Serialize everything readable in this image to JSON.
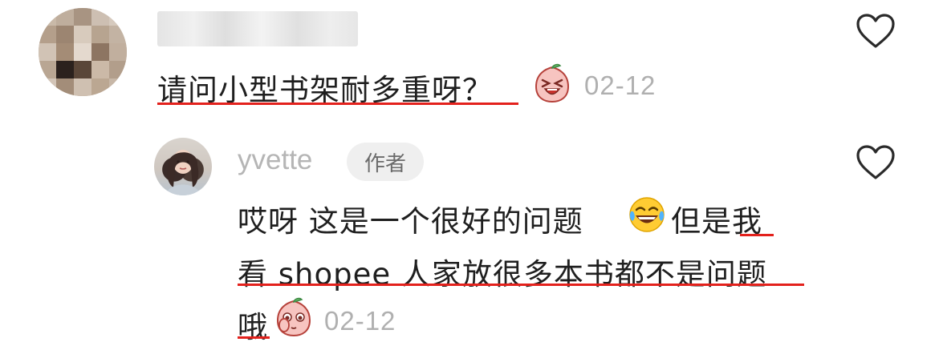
{
  "comment": {
    "text": "请问小型书架耐多重呀？",
    "date": "02-12",
    "sticker": "laughing-peach-sticker",
    "like_icon": "heart-outline-icon"
  },
  "reply": {
    "username": "yvette",
    "author_badge": "作者",
    "line1_a": "哎呀 这是一个很好的问题",
    "line1_emoji": "tears-of-joy-emoji",
    "line1_b": "但是我",
    "line2": "看 shopee 人家放很多本书都不是问题",
    "line3": "哦",
    "sticker": "shy-peach-sticker",
    "date": "02-12",
    "like_icon": "heart-outline-icon"
  },
  "colors": {
    "underline": "#e3211c",
    "text": "#1f1f1f",
    "muted": "#b0b0b0",
    "badge_bg": "#efefef"
  }
}
